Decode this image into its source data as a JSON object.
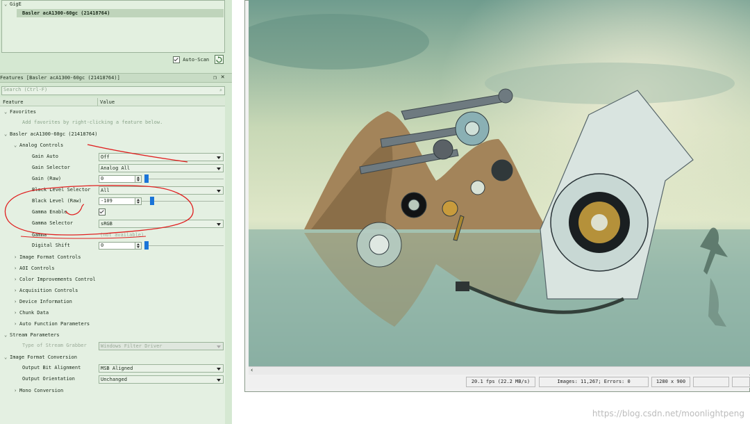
{
  "tree": {
    "gige_label": "GigE",
    "device_label": "Basler acA1300-60gc (21418764)",
    "autoscan_label": "Auto-Scan"
  },
  "features": {
    "title": "Features [Basler acA1300-60gc (21418764)]",
    "search_placeholder": "Search (Ctrl-F)",
    "col_feature": "Feature",
    "col_value": "Value",
    "favorites": "Favorites",
    "favorites_hint": "Add favorites by right-clicking a feature below.",
    "camera": "Basler acA1300-60gc (21418764)",
    "analog_controls": "Analog Controls",
    "rows": [
      {
        "label": "Gain Auto",
        "value": "Off"
      },
      {
        "label": "Gain Selector",
        "value": "Analog All"
      },
      {
        "label": "Gain (Raw)",
        "value": "0"
      },
      {
        "label": "Black Level Selector",
        "value": "All"
      },
      {
        "label": "Black Level (Raw)",
        "value": "-109"
      },
      {
        "label": "Gamma Enable",
        "value": ""
      },
      {
        "label": "Gamma Selector",
        "value": "sRGB"
      },
      {
        "label": "Gamma",
        "value": "(not available)"
      },
      {
        "label": "Digital Shift",
        "value": "0"
      }
    ],
    "groups": [
      "Image Format Controls",
      "AOI Controls",
      "Color Improvements Control",
      "Acquisition Controls",
      "Device Information",
      "Chunk Data",
      "Auto Function Parameters"
    ],
    "stream_params": "Stream Parameters",
    "stream_grabber_label": "Type of Stream Grabber",
    "stream_grabber_value": "Windows Filter Driver",
    "image_format_conversion": "Image Format Conversion",
    "output_bit_label": "Output Bit Alignment",
    "output_bit_value": "MSB Aligned",
    "output_orient_label": "Output Orientation",
    "output_orient_value": "Unchanged",
    "mono_conversion": "Mono Conversion"
  },
  "status": {
    "fps": "20.1 fps (22.2 MB/s)",
    "images": "Images: 11,267; Errors: 0",
    "resolution": "1280 x 900"
  },
  "watermark": "https://blog.csdn.net/moonlightpeng",
  "colors": {
    "panel_bg": "#d5e8d2",
    "slider_accent": "#1a74d8",
    "annotation_red": "#e02020"
  }
}
